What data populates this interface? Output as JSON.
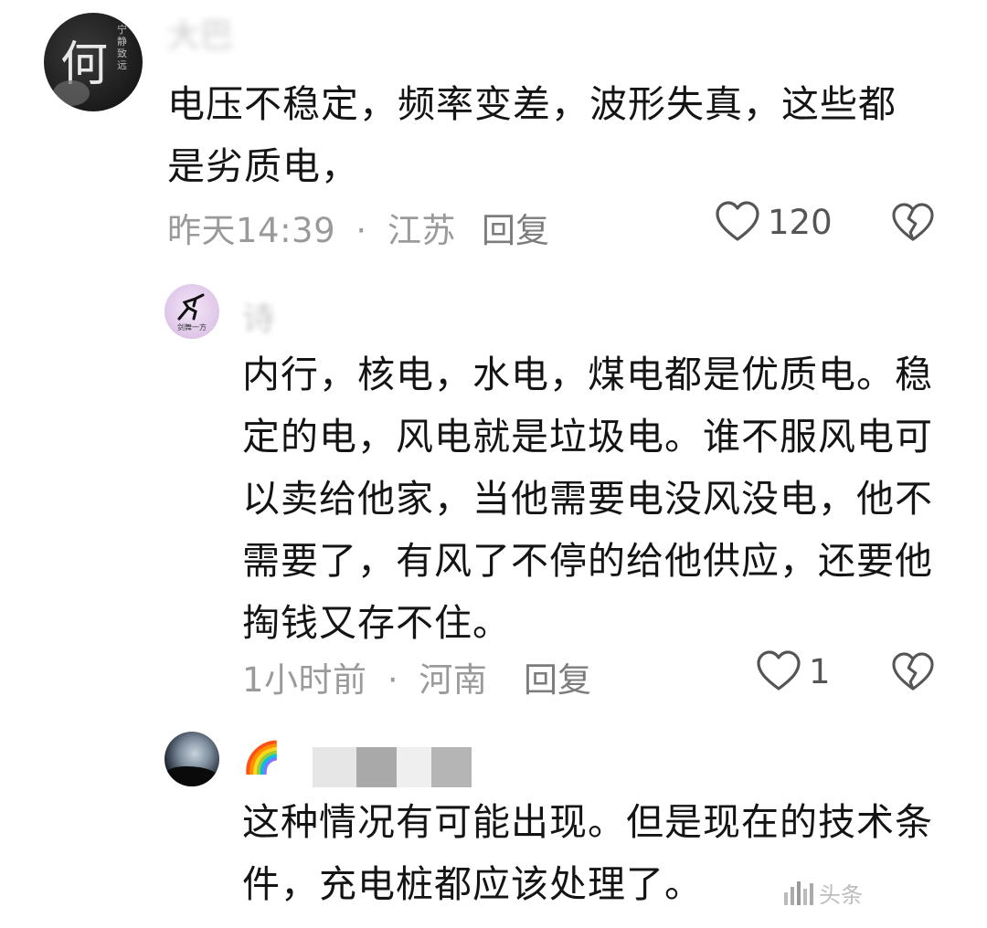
{
  "comments": [
    {
      "avatar_text": "何",
      "avatar_small_text": "宁静致远",
      "username": "大巴",
      "text": "电压不稳定，频率变差，波形失真，这些都是劣质电，",
      "time": "昨天14:39",
      "separator": "·",
      "location": "江苏",
      "reply_label": "回复",
      "likes": "120"
    },
    {
      "avatar_text": "剑舞一方",
      "username": "诗",
      "text": "内行，核电，水电，煤电都是优质电。稳定的电，风电就是垃圾电。谁不服风电可以卖给他家，当他需要电没风没电，他不需要了，有风了不停的给他供应，还要他掏钱又存不住。",
      "time": "1小时前",
      "separator": "·",
      "location": "河南",
      "reply_label": "回复",
      "likes": "1"
    },
    {
      "username": "🌈",
      "text": "这种情况有可能出现。但是现在的技术条件，充电桩都应该处理了。"
    }
  ],
  "icons": {
    "like": "heart-outline-icon",
    "dislike": "broken-heart-icon"
  },
  "colors": {
    "text": "#141414",
    "meta": "#9a9a9a",
    "icon": "#555555"
  },
  "watermark": "头条"
}
